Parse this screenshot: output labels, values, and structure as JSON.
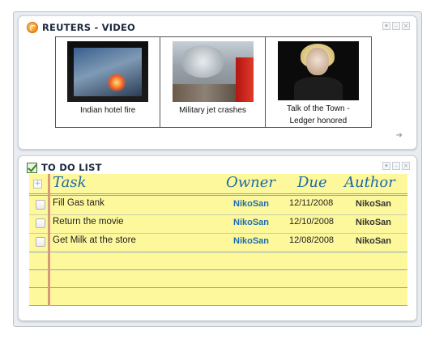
{
  "reuters": {
    "title": "REUTERS - VIDEO",
    "videos": [
      {
        "caption": "Indian hotel fire"
      },
      {
        "caption": "Military jet crashes"
      },
      {
        "caption_line1": "Talk of the Town -",
        "caption_line2": "Ledger honored"
      }
    ]
  },
  "todo": {
    "title": "TO DO LIST",
    "headers": {
      "task": "Task",
      "owner": "Owner",
      "due": "Due",
      "author": "Author"
    },
    "add_symbol": "+",
    "rows": [
      {
        "task": "Fill Gas tank",
        "owner": "NikoSan",
        "due": "12/11/2008",
        "author": "NikoSan"
      },
      {
        "task": "Return the movie",
        "owner": "NikoSan",
        "due": "12/10/2008",
        "author": "NikoSan"
      },
      {
        "task": "Get Milk at the store",
        "owner": "NikoSan",
        "due": "12/08/2008",
        "author": "NikoSan"
      }
    ]
  },
  "colors": {
    "accent": "#1d6aa8",
    "note_yellow": "#fdf89c",
    "owner_blue": "#1f6db0"
  }
}
